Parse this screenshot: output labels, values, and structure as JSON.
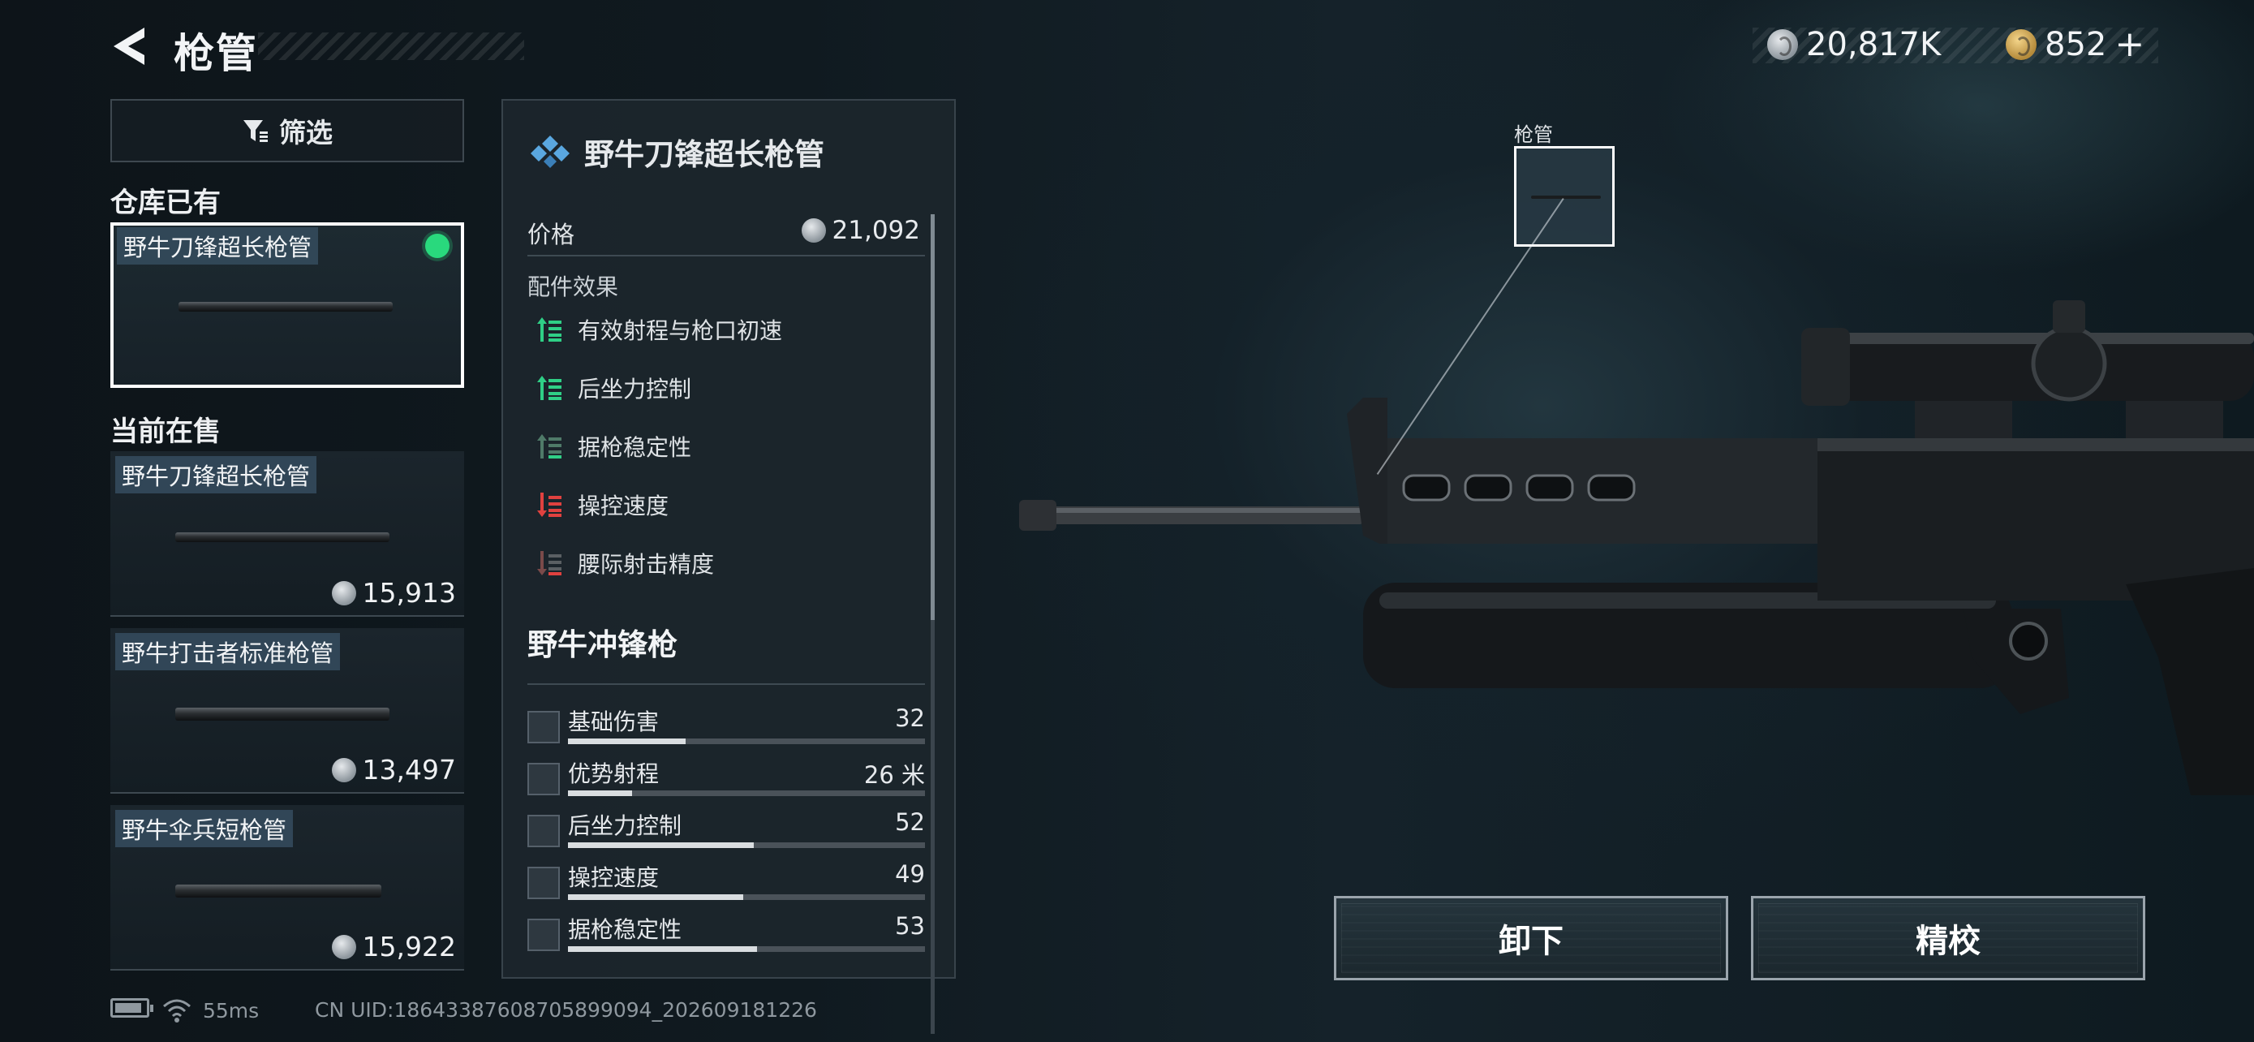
{
  "header": {
    "title": "枪管",
    "currency_silver": "20,817K",
    "currency_gold": "852",
    "plus_label": "+"
  },
  "sidebar": {
    "filter_label": "筛选",
    "owned_section": "仓库已有",
    "owned_items": [
      {
        "name": "野牛刀锋超长枪管",
        "equipped": true
      }
    ],
    "sale_section": "当前在售",
    "sale_items": [
      {
        "name": "野牛刀锋超长枪管",
        "price": "15,913"
      },
      {
        "name": "野牛打击者标准枪管",
        "price": "13,497"
      },
      {
        "name": "野牛伞兵短枪管",
        "price": "15,922"
      }
    ]
  },
  "detail": {
    "title": "野牛刀锋超长枪管",
    "price_label": "价格",
    "price_value": "21,092",
    "effects_label": "配件效果",
    "effects": [
      {
        "label": "有效射程与枪口初速",
        "type": "increase",
        "color": "#2fcf86"
      },
      {
        "label": "后坐力控制",
        "type": "increase",
        "color": "#2fcf86"
      },
      {
        "label": "据枪稳定性",
        "type": "increase-minor",
        "color": "#4f7a68"
      },
      {
        "label": "操控速度",
        "type": "decrease",
        "color": "#e0413f"
      },
      {
        "label": "腰际射击精度",
        "type": "decrease-minor",
        "color": "#7a4a4a"
      }
    ],
    "weapon_name": "野牛冲锋枪",
    "stats": [
      {
        "label": "基础伤害",
        "value": "32",
        "level": 0.33,
        "icon": "damage-icon"
      },
      {
        "label": "优势射程",
        "value": "26 米",
        "level": 0.18,
        "icon": "range-icon"
      },
      {
        "label": "后坐力控制",
        "value": "52",
        "level": 0.52,
        "icon": "recoil-icon"
      },
      {
        "label": "操控速度",
        "value": "49",
        "level": 0.49,
        "icon": "handling-icon"
      },
      {
        "label": "据枪稳定性",
        "value": "53",
        "level": 0.53,
        "icon": "stability-icon"
      }
    ]
  },
  "showcase": {
    "attachment_slot_label": "枪管"
  },
  "actions": {
    "unequip_label": "卸下",
    "tune_label": "精校"
  },
  "status_bar": {
    "ping": "55ms",
    "uid": "CN UID:186433876087058990​94_202609181226"
  }
}
